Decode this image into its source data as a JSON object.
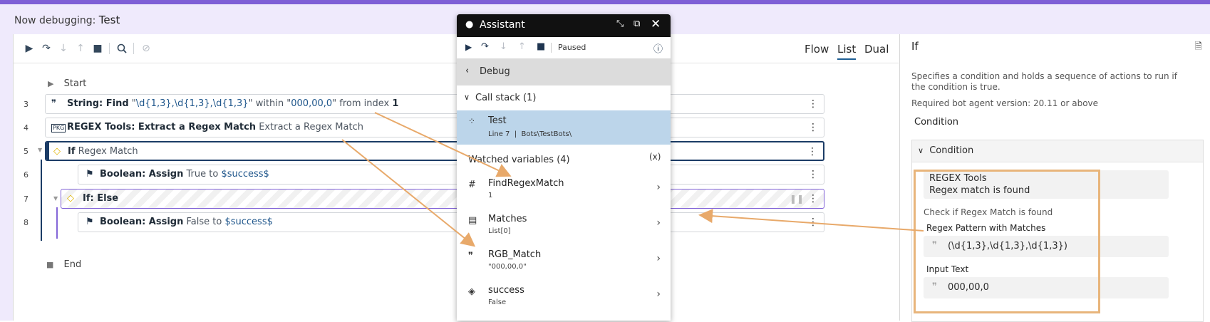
{
  "header": {
    "prefix": "Now debugging:",
    "bot_name": "Test"
  },
  "toolbar": {
    "views": [
      "Flow",
      "List",
      "Dual"
    ],
    "active_view": "List"
  },
  "flow": {
    "start": "Start",
    "end": "End",
    "lines": [
      {
        "num": "3",
        "bold": "String: Find",
        "q1": "\"",
        "pattern": "\\d{1,3},\\d{1,3},\\d{1,3}",
        "q2": "\"",
        "mid": "within",
        "q3": "\"",
        "text": "000,00,0",
        "q4": "\"",
        "tail": "from index",
        "idx": "1"
      },
      {
        "num": "4",
        "bold": "REGEX Tools: Extract a Regex Match",
        "rest": "Extract a Regex Match"
      },
      {
        "num": "5",
        "kw": "If",
        "rest": "Regex Match"
      },
      {
        "num": "6",
        "bold": "Boolean: Assign",
        "mid": "True to",
        "var": "$success$"
      },
      {
        "num": "7",
        "kw": "If: Else"
      },
      {
        "num": "8",
        "bold": "Boolean: Assign",
        "mid": "False to",
        "var": "$success$"
      }
    ]
  },
  "right_panel": {
    "title": "If",
    "description": "Specifies a condition and holds a sequence of actions to run if the condition is true.",
    "version": "Required bot agent version: 20.11 or above",
    "condition_label": "Condition",
    "section_title": "Condition",
    "card_title": "REGEX Tools",
    "card_sub": "Regex match is found",
    "check_text": "Check if Regex Match is found",
    "pattern_label": "Regex Pattern with Matches",
    "pattern_value": "(\\d{1,3},\\d{1,3},\\d{1,3})",
    "input_label": "Input Text",
    "input_value": "000,00,0"
  },
  "assistant": {
    "title": "Assistant",
    "status": "Paused",
    "debug_label": "Debug",
    "call_stack_label": "Call stack (1)",
    "call_item": {
      "name": "Test",
      "detail": "Line 7  |  Bots\\TestBots\\"
    },
    "watched_label": "Watched variables (4)",
    "variables": [
      {
        "name": "FindRegexMatch",
        "value": "1",
        "icon": "number-icon"
      },
      {
        "name": "Matches",
        "value": "List[0]",
        "icon": "list-icon"
      },
      {
        "name": "RGB_Match",
        "value": "\"000,00,0\"",
        "icon": "quote-icon"
      },
      {
        "name": "success",
        "value": "False",
        "icon": "boolean-icon"
      }
    ]
  },
  "colors": {
    "accent": "#7e5fd6",
    "selection": "#bcd5ea",
    "annotation": "#e8b57b",
    "keyword": "#e8752d"
  }
}
